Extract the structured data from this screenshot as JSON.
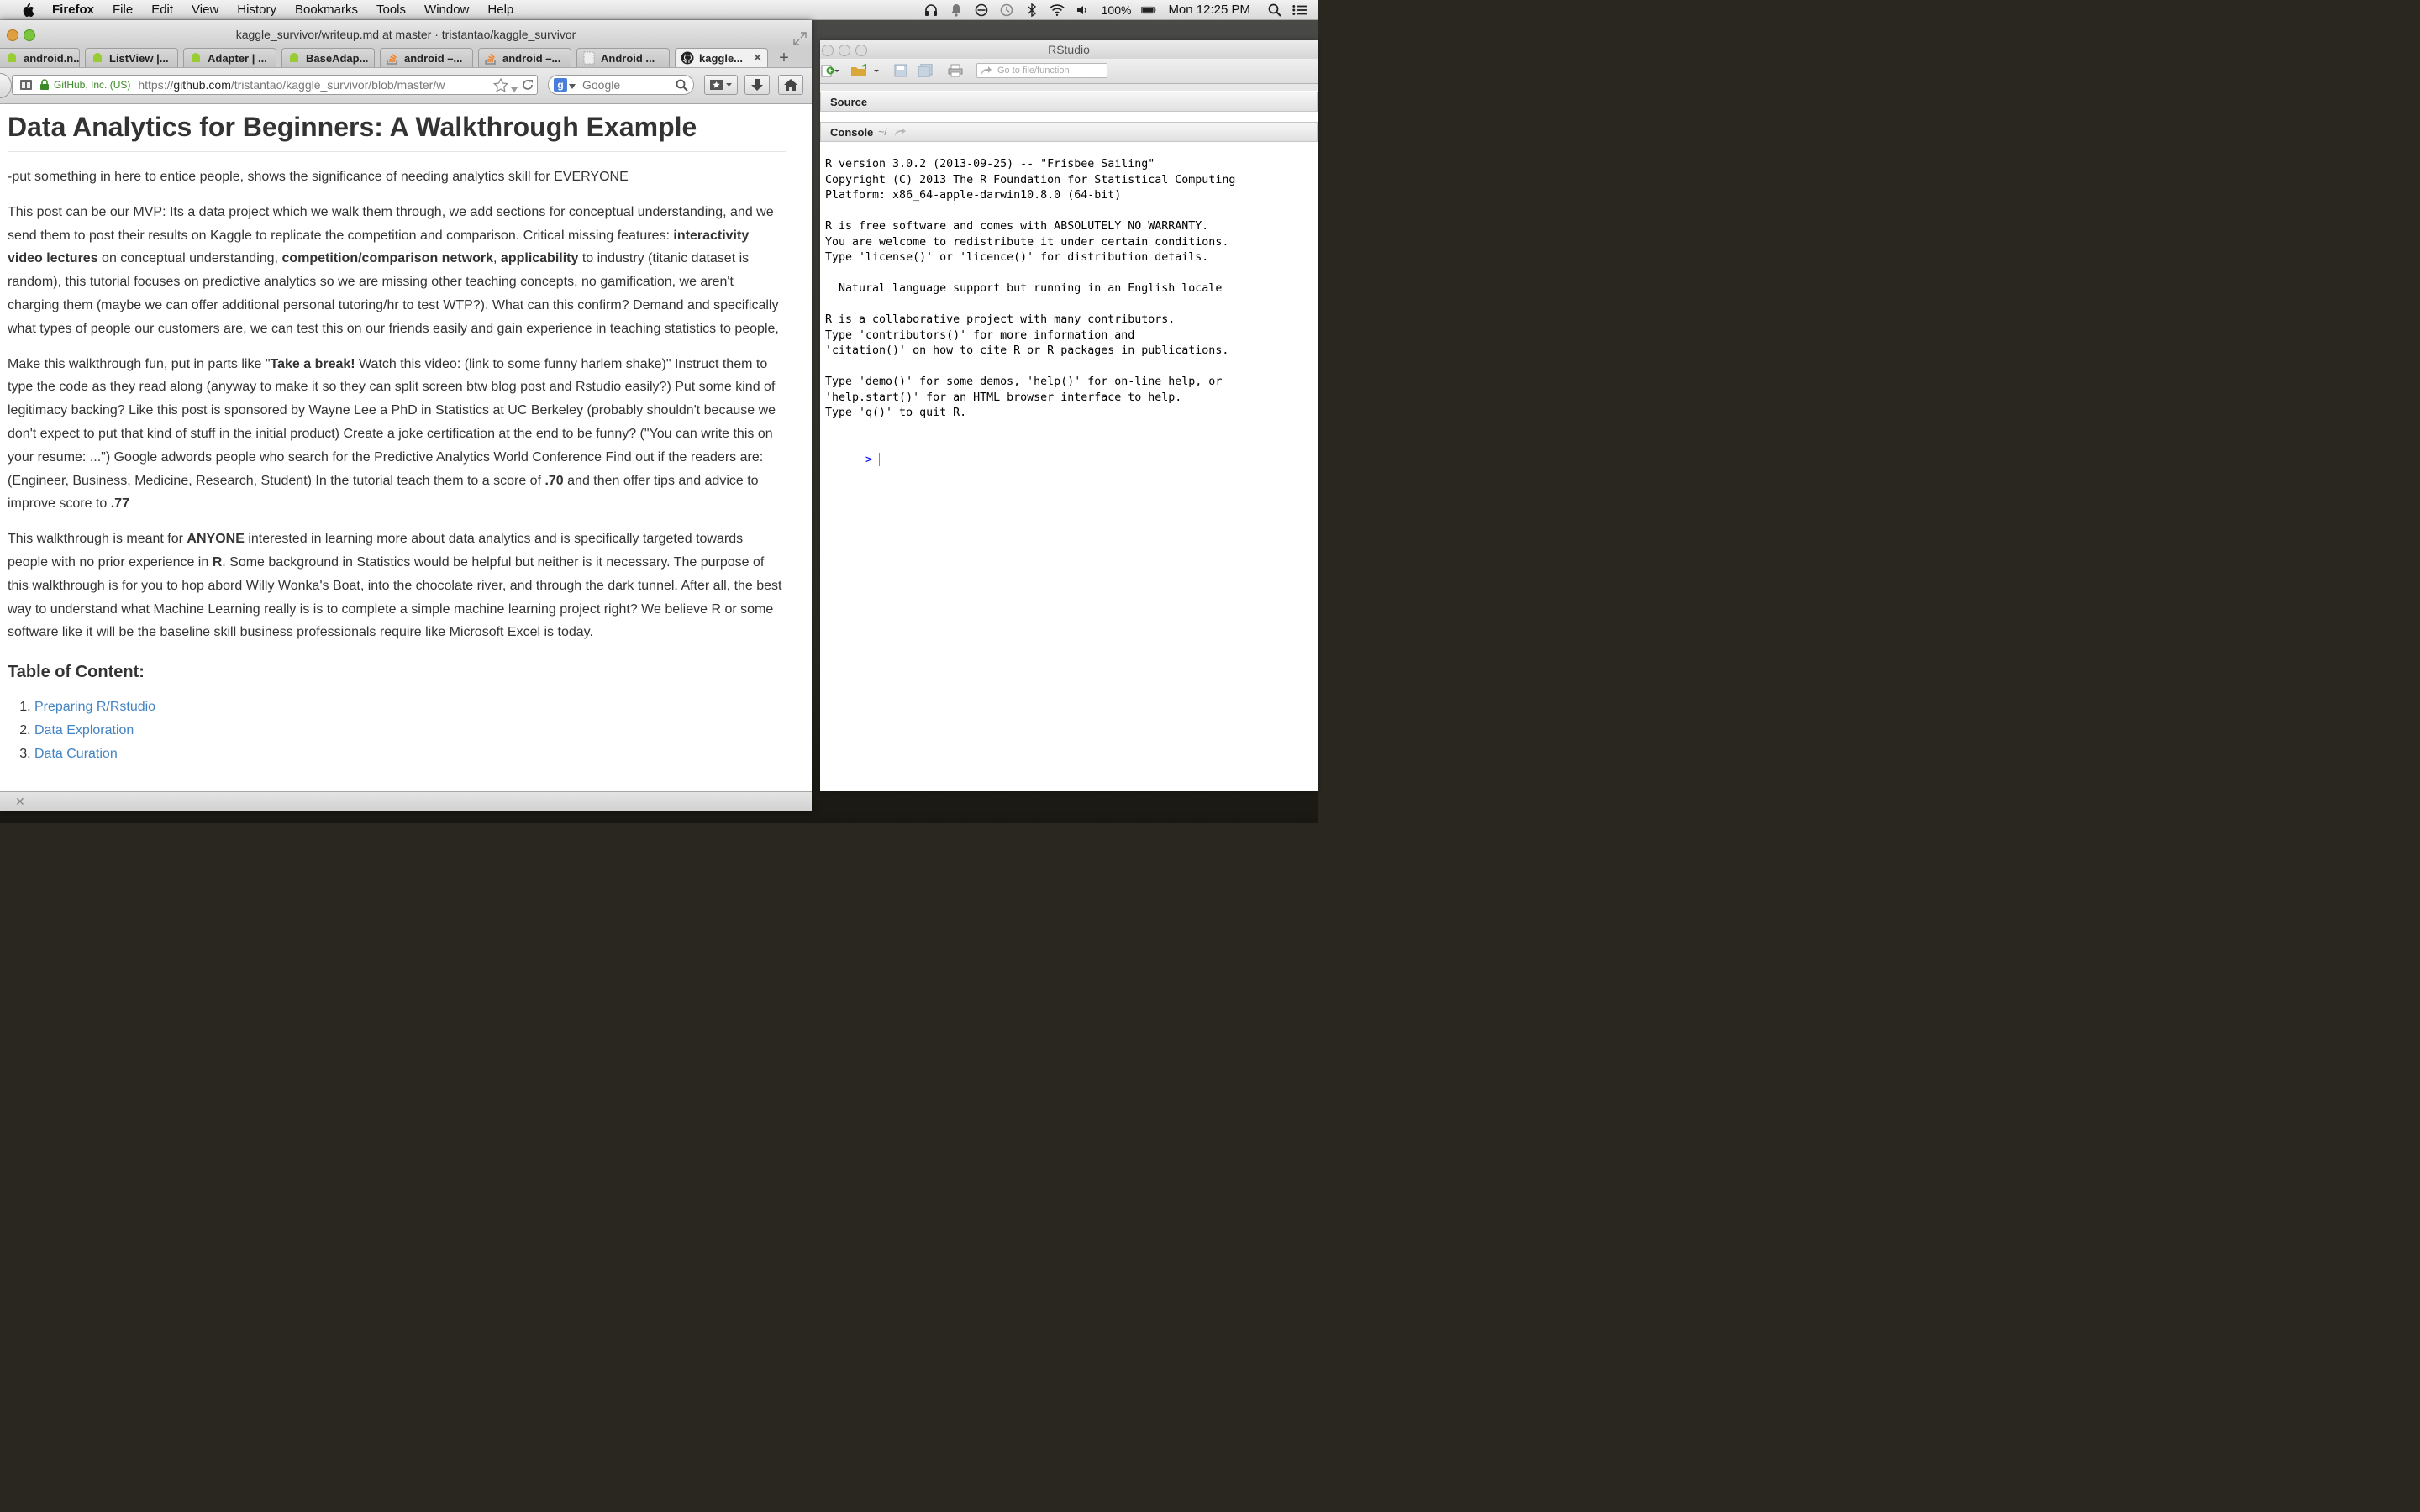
{
  "menubar": {
    "app_name": "Firefox",
    "items": [
      "File",
      "Edit",
      "View",
      "History",
      "Bookmarks",
      "Tools",
      "Window",
      "Help"
    ],
    "battery": "100%",
    "clock": "Mon 12:25 PM"
  },
  "firefox": {
    "window_title": "kaggle_survivor/writeup.md at master · tristantao/kaggle_survivor",
    "tabs": [
      {
        "label": "android.n...",
        "icon": "android-icon"
      },
      {
        "label": "ListView |...",
        "icon": "android-icon"
      },
      {
        "label": "Adapter | ...",
        "icon": "android-icon"
      },
      {
        "label": "BaseAdap...",
        "icon": "android-icon"
      },
      {
        "label": "android –...",
        "icon": "stackoverflow-icon"
      },
      {
        "label": "android –...",
        "icon": "stackoverflow-icon"
      },
      {
        "label": "Android ...",
        "icon": "blank-page-icon"
      },
      {
        "label": "kaggle...",
        "icon": "github-icon"
      }
    ],
    "identity": "GitHub, Inc. (US)",
    "url_scheme": "https://",
    "url_host": "github.com",
    "url_path": "/tristantao/kaggle_survivor/blob/master/w",
    "search_placeholder": "Google"
  },
  "doc": {
    "title": "Data Analytics for Beginners: A Walkthrough Example",
    "p1": "-put something in here to entice people, shows the significance of needing analytics skill for EVERYONE",
    "p2": {
      "t1": "This post can be our MVP: Its a data project which we walk them through, we add sections for conceptual understanding, and we send them to post their results on Kaggle to replicate the competition and comparison. Critical missing features: ",
      "b1": "interactivity video lectures",
      "t2": " on conceptual understanding, ",
      "b2": "competition/comparison network",
      "t3": ", ",
      "b3": "applicability",
      "t4": " to industry (titanic dataset is random), this tutorial focuses on predictive analytics so we are missing other teaching concepts, no gamification, we aren't charging them (maybe we can offer additional personal tutoring/hr to test WTP?). What can this confirm? Demand and specifically what types of people our customers are, we can test this on our friends easily and gain experience in teaching statistics to people,"
    },
    "p3": {
      "t1": "Make this walkthrough fun, put in parts like \"",
      "b1": "Take a break!",
      "t2": " Watch this video: (link to some funny harlem shake)\" Instruct them to type the code as they read along (anyway to make it so they can split screen btw blog post and Rstudio easily?) Put some kind of legitimacy backing? Like this post is sponsored by Wayne Lee a PhD in Statistics at UC Berkeley (probably shouldn't because we don't expect to put that kind of stuff in the initial product) Create a joke certification at the end to be funny? (\"You can write this on your resume: ...\") Google adwords people who search for the Predictive Analytics World Conference Find out if the readers are: (Engineer, Business, Medicine, Research, Student) In the tutorial teach them to a score of ",
      "b2": ".70",
      "t3": " and then offer tips and advice to improve score to ",
      "b3": ".77"
    },
    "p4": {
      "t1": "This walkthrough is meant for ",
      "b1": "ANYONE",
      "t2": " interested in learning more about data analytics and is specifically targeted towards people with no prior experience in ",
      "b2": "R",
      "t3": ". Some background in Statistics would be helpful but neither is it necessary. The purpose of this walkthrough is for you to hop abord Willy Wonka's Boat, into the chocolate river, and through the dark tunnel. After all, the best way to understand what Machine Learning really is is to complete a simple machine learning project right? We believe R or some software like it will be the baseline skill business professionals require like Microsoft Excel is today."
    },
    "toc_title": "Table of Content:",
    "toc": [
      {
        "num": "1.",
        "label": "Preparing R/Rstudio"
      },
      {
        "num": "2.",
        "label": "Data Exploration"
      },
      {
        "num": "3.",
        "label": "Data Curation"
      }
    ]
  },
  "rstudio": {
    "window_title": "RStudio",
    "goto_placeholder": "Go to file/function",
    "source_label": "Source",
    "console_label": "Console",
    "console_path": "~/",
    "console_lines": [
      "R version 3.0.2 (2013-09-25) -- \"Frisbee Sailing\"",
      "Copyright (C) 2013 The R Foundation for Statistical Computing",
      "Platform: x86_64-apple-darwin10.8.0 (64-bit)",
      "",
      "R is free software and comes with ABSOLUTELY NO WARRANTY.",
      "You are welcome to redistribute it under certain conditions.",
      "Type 'license()' or 'licence()' for distribution details.",
      "",
      "  Natural language support but running in an English locale",
      "",
      "R is a collaborative project with many contributors.",
      "Type 'contributors()' for more information and",
      "'citation()' on how to cite R or R packages in publications.",
      "",
      "Type 'demo()' for some demos, 'help()' for on-line help, or",
      "'help.start()' for an HTML browser interface to help.",
      "Type 'q()' to quit R."
    ],
    "prompt": ">"
  },
  "colors": {
    "link": "#4183c4",
    "ssl_green": "#3b8a28",
    "r_prompt": "#0000ff"
  }
}
